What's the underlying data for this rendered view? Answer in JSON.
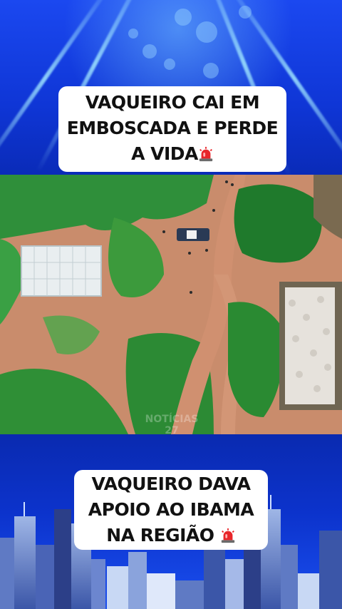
{
  "caption_top": {
    "line1": "VAQUEIRO CAI EM",
    "line2": "EMBOSCADA E PERDE",
    "line3": "A VIDA",
    "emoji": "police-light-icon"
  },
  "caption_bottom": {
    "line1": "VAQUEIRO DAVA",
    "line2": "APOIO AO IBAMA",
    "line3": "NA REGIÃO",
    "emoji": "police-light-icon"
  },
  "watermark": {
    "line1": "NOTÍCIAS",
    "line2": "27"
  },
  "colors": {
    "background_blue": "#0f36d6",
    "caption_bg": "#ffffff",
    "caption_text": "#111111",
    "siren_red": "#e8262a"
  }
}
